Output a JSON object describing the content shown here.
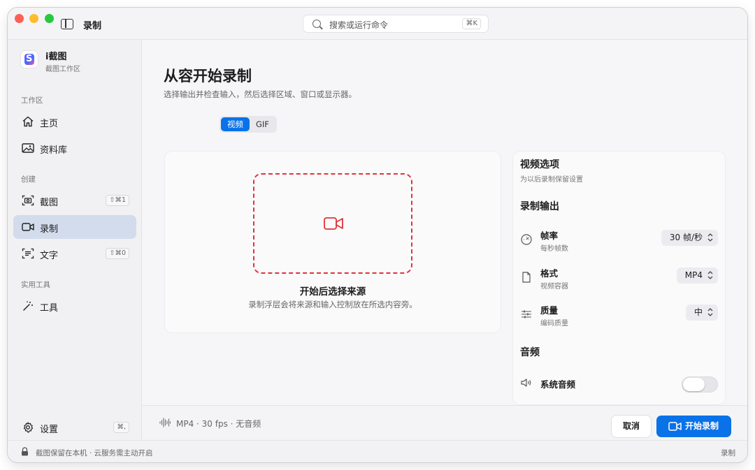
{
  "window": {
    "app_title": "录制",
    "search_placeholder": "搜索或运行命令",
    "search_shortcut": "⌘K"
  },
  "sidebar": {
    "brand_name": "i截图",
    "brand_sub": "截图工作区",
    "sections": {
      "workspace": "工作区",
      "create": "创建",
      "tools": "实用工具"
    },
    "items": {
      "home": {
        "label": "主页",
        "icon": "home-icon"
      },
      "library": {
        "label": "资料库",
        "icon": "image-icon"
      },
      "screenshot": {
        "label": "截图",
        "icon": "camera-icon",
        "shortcut": "⇧⌘1"
      },
      "record": {
        "label": "录制",
        "icon": "video-icon",
        "active": true
      },
      "text": {
        "label": "文字",
        "icon": "text-scan-icon",
        "shortcut": "⇧⌘0"
      },
      "tools": {
        "label": "工具",
        "icon": "magic-wand-icon"
      }
    },
    "settings": {
      "label": "设置",
      "shortcut": "⌘,",
      "icon": "gear-icon"
    }
  },
  "main": {
    "title": "从容开始录制",
    "subtitle": "选择输出并检查输入，然后选择区域、窗口或显示器。",
    "mode_tabs": [
      {
        "label": "视频",
        "active": true
      },
      {
        "label": "GIF",
        "active": false
      }
    ],
    "drop": {
      "title": "开始后选择来源",
      "subtitle": "录制浮层会将来源和输入控制放在所选内容旁。",
      "icon": "video-camera-icon",
      "accent": "#e0333a"
    },
    "options": {
      "title": "视频选项",
      "subtitle": "为以后录制保留设置",
      "output_section": "录制输出",
      "rows": {
        "fps": {
          "label": "帧率",
          "desc": "每秒帧数",
          "value": "30 帧/秒",
          "icon": "gauge-icon"
        },
        "format": {
          "label": "格式",
          "desc": "视频容器",
          "value": "MP4",
          "icon": "document-icon"
        },
        "quality": {
          "label": "质量",
          "desc": "编码质量",
          "value": "中",
          "icon": "sliders-icon"
        }
      },
      "audio_section": "音频",
      "system_audio": {
        "label": "系统音频",
        "enabled": false,
        "icon": "speaker-icon"
      }
    },
    "footer": {
      "info": "MP4 · 30 fps · 无音频",
      "cancel": "取消",
      "start": "开始录制"
    }
  },
  "statusbar": {
    "text": "截图保留在本机 · 云服务需主动开启",
    "right": "录制"
  },
  "colors": {
    "accent": "#0a72e8",
    "active_nav": "#d2dcec",
    "record_red": "#e0333a"
  }
}
